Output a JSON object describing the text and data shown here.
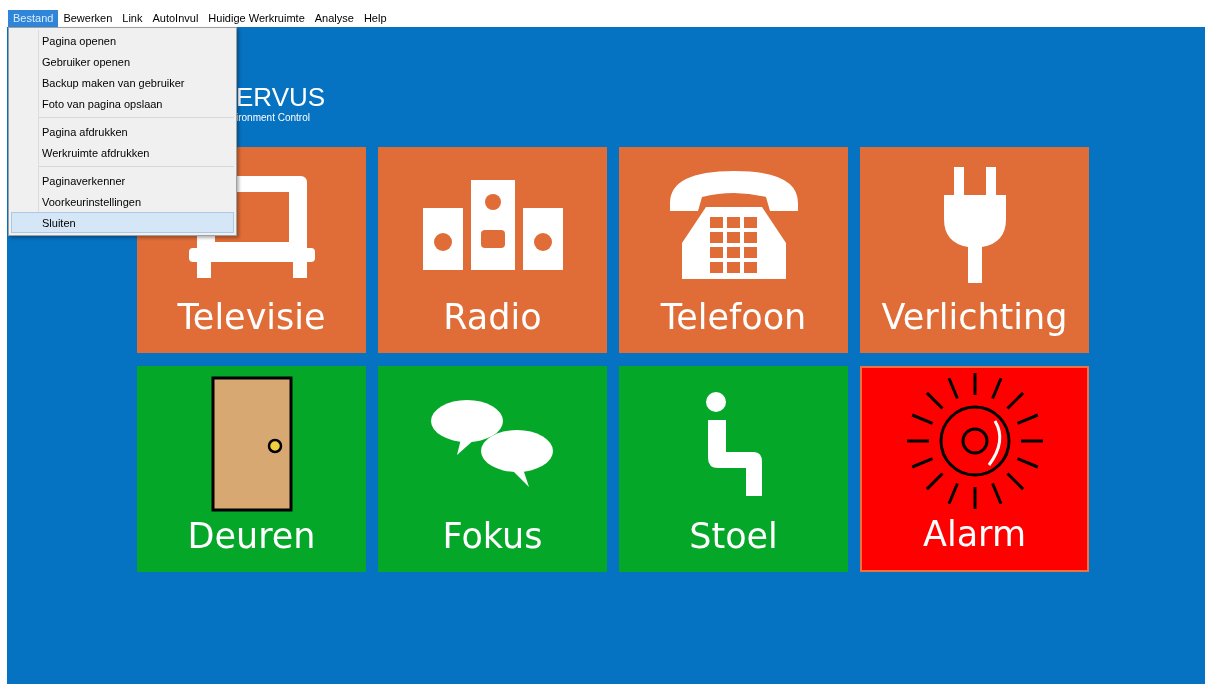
{
  "menu_bar": [
    {
      "label": "Bestand",
      "selected": true
    },
    {
      "label": "Bewerken",
      "selected": false
    },
    {
      "label": "Link",
      "selected": false
    },
    {
      "label": "AutoInvul",
      "selected": false
    },
    {
      "label": "Huidige Werkruimte",
      "selected": false
    },
    {
      "label": "Analyse",
      "selected": false
    },
    {
      "label": "Help",
      "selected": false
    }
  ],
  "dropdown": {
    "groups": [
      [
        {
          "label": "Pagina openen",
          "selected": false
        },
        {
          "label": "Gebruiker openen",
          "selected": false
        },
        {
          "label": "Backup maken van gebruiker",
          "selected": false
        },
        {
          "label": "Foto van pagina opslaan",
          "selected": false
        }
      ],
      [
        {
          "label": "Pagina afdrukken",
          "selected": false
        },
        {
          "label": "Werkruimte afdrukken",
          "selected": false
        }
      ],
      [
        {
          "label": "Paginaverkenner",
          "selected": false
        },
        {
          "label": "Voorkeurinstellingen",
          "selected": false
        },
        {
          "label": "Sluiten",
          "selected": true
        }
      ]
    ]
  },
  "logo": {
    "title": "ERVUS",
    "subtitle": "ironment Control"
  },
  "tiles": [
    {
      "label": "Televisie",
      "kind": "tv",
      "color": "#e06c37"
    },
    {
      "label": "Radio",
      "kind": "radio",
      "color": "#e06c37"
    },
    {
      "label": "Telefoon",
      "kind": "phone",
      "color": "#e06c37"
    },
    {
      "label": "Verlichting",
      "kind": "plug",
      "color": "#e06c37"
    },
    {
      "label": "Deuren",
      "kind": "door",
      "color": "#04a728"
    },
    {
      "label": "Fokus",
      "kind": "chat",
      "color": "#04a728"
    },
    {
      "label": "Stoel",
      "kind": "chair",
      "color": "#04a728"
    },
    {
      "label": "Alarm",
      "kind": "alarm",
      "color": "#ff0000"
    }
  ]
}
